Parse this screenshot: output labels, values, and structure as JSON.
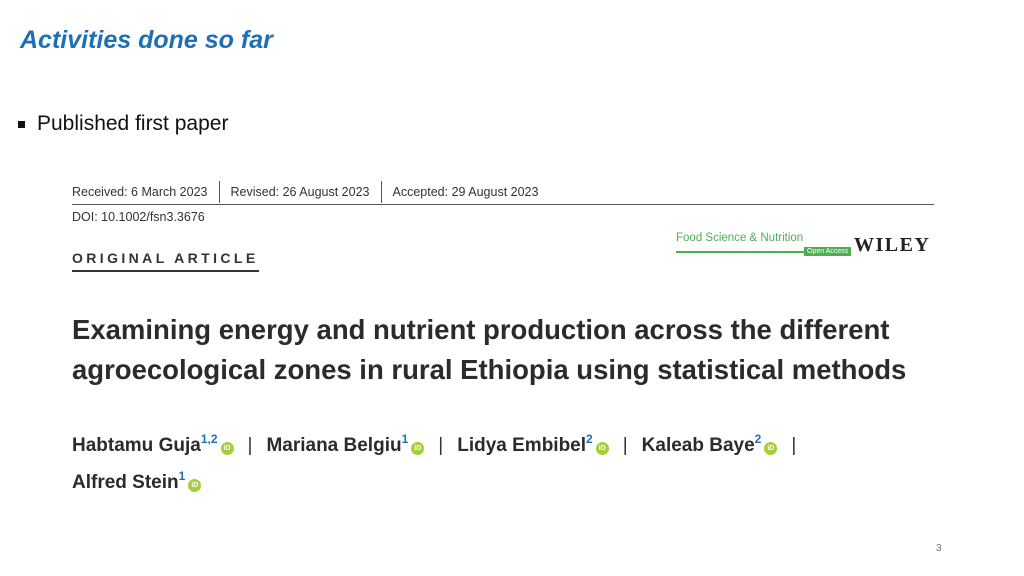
{
  "slide": {
    "title": "Activities done so far",
    "bullet": "Published first paper",
    "page_number": "3"
  },
  "paper": {
    "received": "Received: 6 March 2023",
    "revised": "Revised: 26 August 2023",
    "accepted": "Accepted: 29 August 2023",
    "doi": "DOI: 10.1002/fsn3.3676",
    "article_type": "ORIGINAL ARTICLE",
    "journal": "Food Science & Nutrition",
    "journal_badge": "Open Access",
    "publisher": "WILEY",
    "title": "Examining energy and nutrient production across the different agroecological zones in rural Ethiopia using statistical methods",
    "authors": [
      {
        "name": "Habtamu Guja",
        "affiliations": "1,2",
        "orcid": "iD"
      },
      {
        "name": "Mariana Belgiu",
        "affiliations": "1",
        "orcid": "iD"
      },
      {
        "name": "Lidya Embibel",
        "affiliations": "2",
        "orcid": "iD"
      },
      {
        "name": "Kaleab Baye",
        "affiliations": "2",
        "orcid": "iD"
      },
      {
        "name": "Alfred Stein",
        "affiliations": "1",
        "orcid": "iD"
      }
    ],
    "author_separator": "|"
  },
  "colors": {
    "slide_title": "#1f6fb5",
    "journal_green": "#4caf50",
    "orcid_green": "#a6ce39",
    "affiliation_blue": "#1f6fb5"
  }
}
